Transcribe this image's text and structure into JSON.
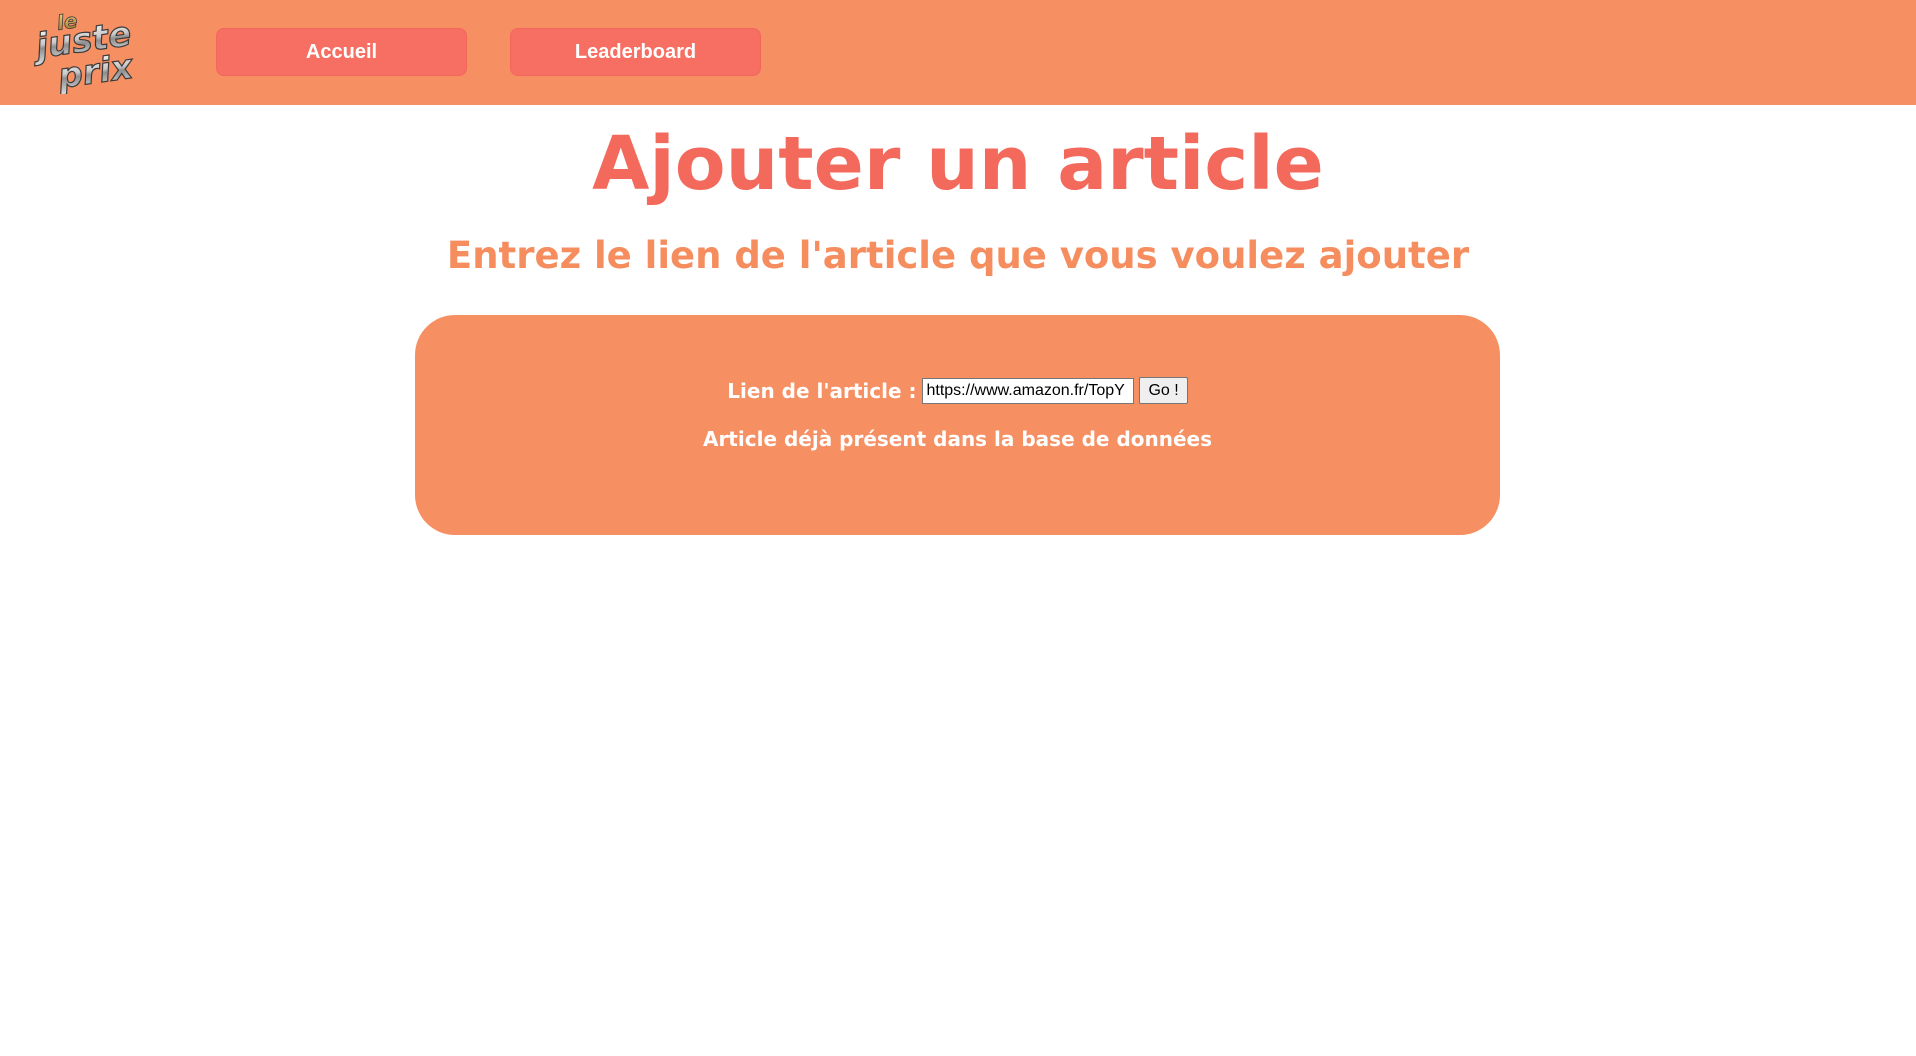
{
  "nav": {
    "logo_text": [
      "le",
      "juste",
      "prix"
    ],
    "home_label": "Accueil",
    "leaderboard_label": "Leaderboard"
  },
  "main": {
    "title": "Ajouter un article",
    "subtitle": "Entrez le lien de l'article que vous voulez ajouter"
  },
  "form": {
    "label": "Lien de l'article :",
    "url_value": "https://www.amazon.fr/TopY",
    "submit_label": "Go !",
    "status_message": "Article déjà présent dans la base de données"
  },
  "colors": {
    "navbar_bg": "#f68f62",
    "nav_button_bg": "#f76e62",
    "title": "#f36a5d",
    "subtitle": "#f58d5f",
    "card_bg": "#f68f62"
  }
}
